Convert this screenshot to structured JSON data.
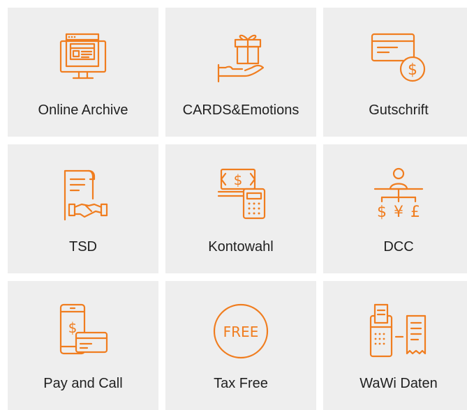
{
  "accent_color": "#f07d1f",
  "tile_background": "#eeeeee",
  "tiles": [
    {
      "label": "Online Archive",
      "icon": "monitor-archive-icon"
    },
    {
      "label": "CARDS&Emotions",
      "icon": "gift-hand-icon"
    },
    {
      "label": "Gutschrift",
      "icon": "card-credit-icon"
    },
    {
      "label": "TSD",
      "icon": "document-handshake-icon"
    },
    {
      "label": "Kontowahl",
      "icon": "cash-calculator-icon"
    },
    {
      "label": "DCC",
      "icon": "currency-exchange-icon"
    },
    {
      "label": "Pay and Call",
      "icon": "phone-card-icon"
    },
    {
      "label": "Tax Free",
      "icon": "free-badge-icon"
    },
    {
      "label": "WaWi Daten",
      "icon": "terminal-receipt-icon"
    }
  ],
  "icon_text": {
    "dollar": "$",
    "yen": "¥",
    "pound": "£",
    "free": "FREE"
  }
}
